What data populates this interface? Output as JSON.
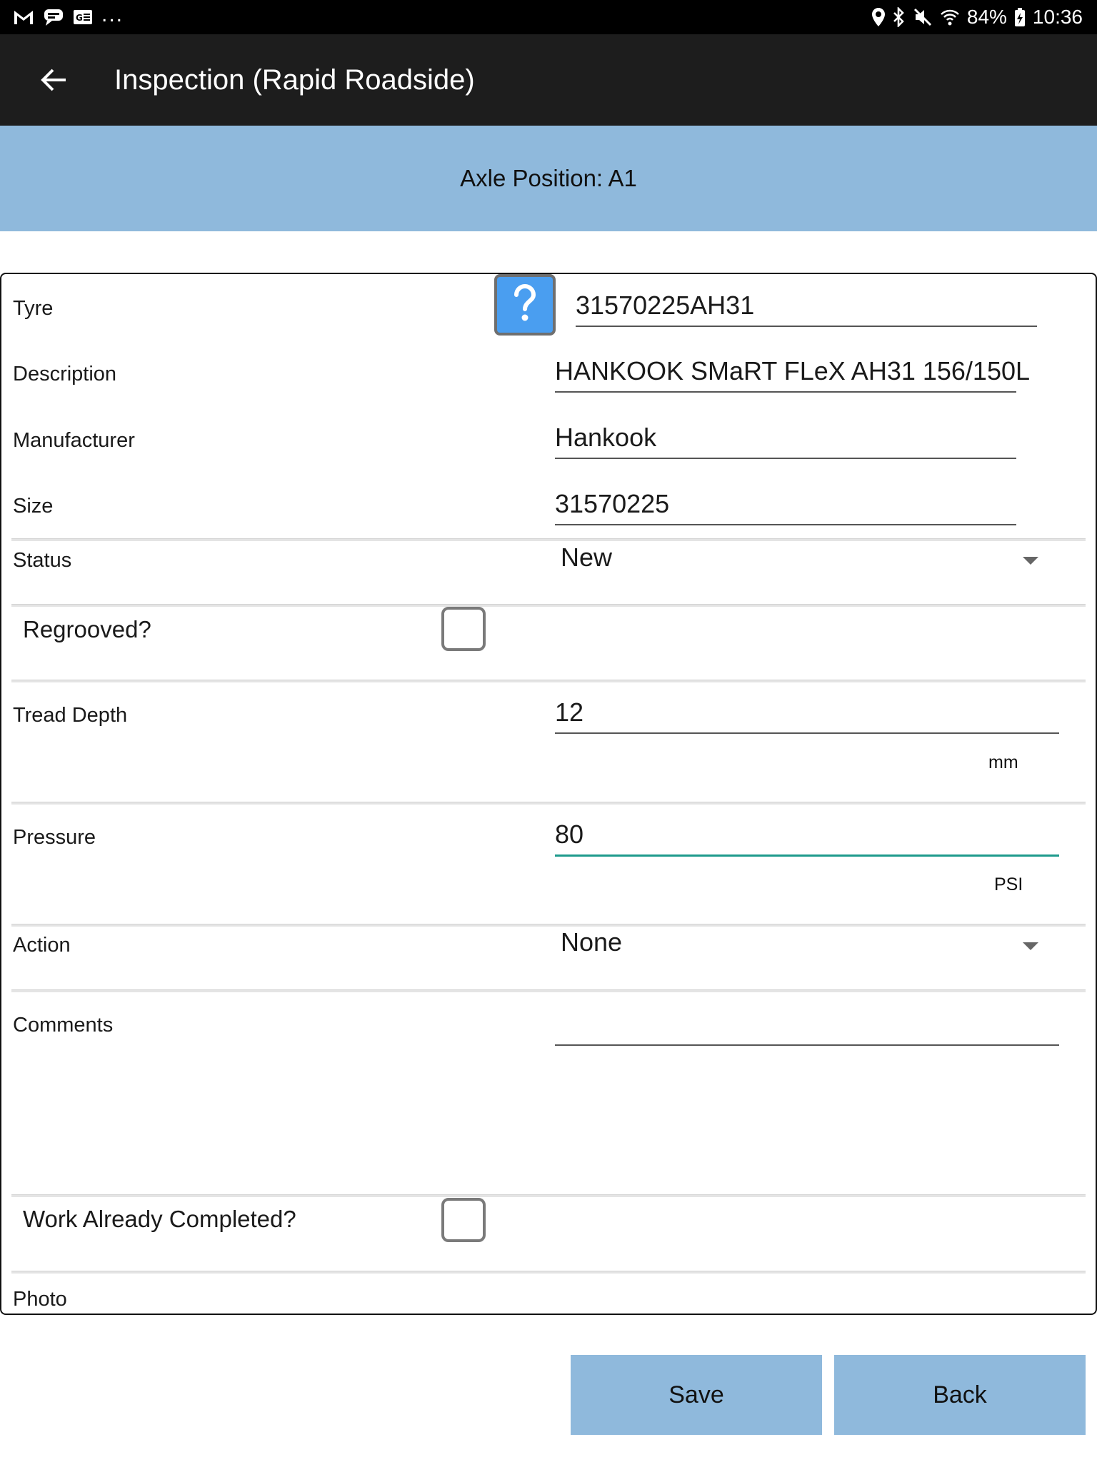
{
  "status_bar": {
    "battery": "84%",
    "time": "10:36",
    "more": "..."
  },
  "app_bar": {
    "title": "Inspection (Rapid Roadside)"
  },
  "banner": {
    "axle_position": "Axle Position: A1"
  },
  "form": {
    "tyre": {
      "label": "Tyre",
      "value": "31570225AH31"
    },
    "description": {
      "label": "Description",
      "value": "HANKOOK SMaRT FLeX AH31 156/150L"
    },
    "manufacturer": {
      "label": "Manufacturer",
      "value": "Hankook"
    },
    "size": {
      "label": "Size",
      "value": "31570225"
    },
    "status": {
      "label": "Status",
      "selected": "New"
    },
    "regrooved": {
      "label": "Regrooved?",
      "checked": false
    },
    "tread_depth": {
      "label": "Tread Depth",
      "value": "12",
      "unit": "mm"
    },
    "pressure": {
      "label": "Pressure",
      "value": "80",
      "unit": "PSI"
    },
    "action": {
      "label": "Action",
      "selected": "None"
    },
    "comments": {
      "label": "Comments",
      "value": ""
    },
    "work_completed": {
      "label": "Work Already Completed?",
      "checked": false
    },
    "photo": {
      "label": "Photo"
    }
  },
  "buttons": {
    "save": "Save",
    "back": "Back"
  },
  "colors": {
    "accent_banner": "#8fb9dc",
    "app_bar": "#1d1d1d",
    "focus_underline": "#1d9a8c",
    "help_button": "#4a9ef0"
  }
}
